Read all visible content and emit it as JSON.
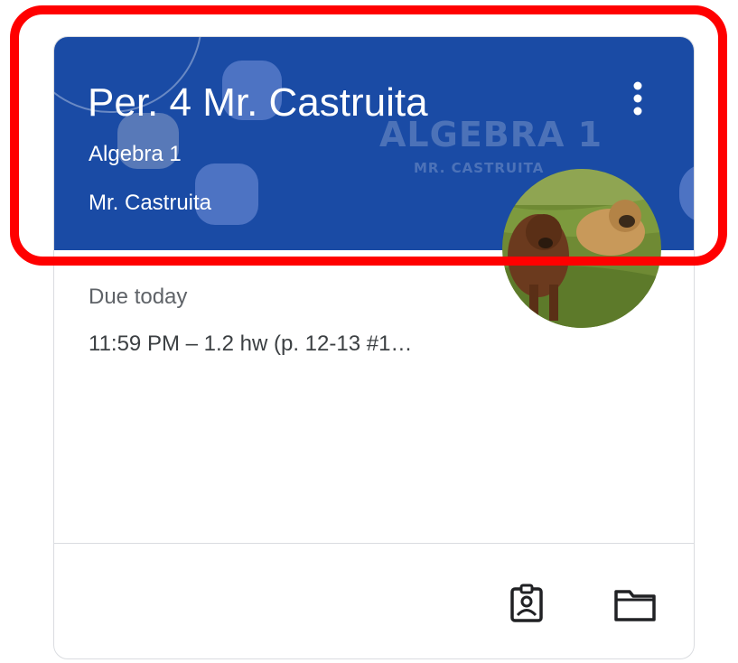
{
  "card": {
    "title": "Per. 4 Mr. Castruita",
    "section": "Algebra 1",
    "teacher": "Mr. Castruita",
    "banner_watermark": {
      "line1": "ALGEBRA 1",
      "line2": "MR. CASTRUITA"
    },
    "header_color": "#1a4ba5",
    "due": {
      "label": "Due today",
      "item": "11:59 PM – 1.2 hw (p. 12-13 #1…"
    },
    "footer_icons": [
      "assignment-ind-icon",
      "folder-icon"
    ]
  },
  "highlight_color": "#ff0000"
}
